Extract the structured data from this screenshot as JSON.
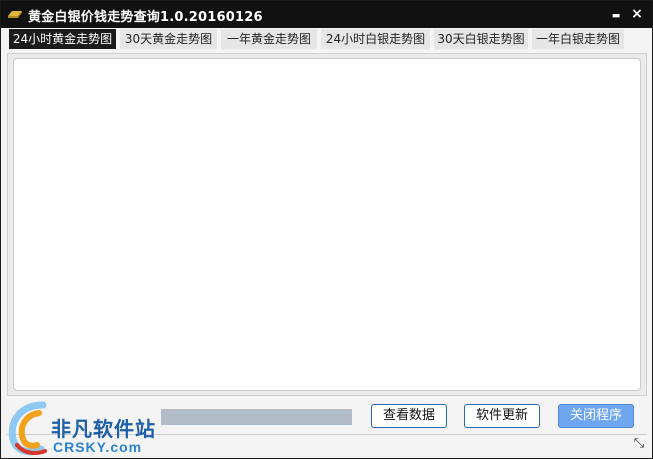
{
  "window": {
    "title": "黄金白银价钱走势查询1.0.20160126",
    "minimize_glyph": "▬",
    "close_glyph": "×",
    "icon": "gold-bar-icon"
  },
  "tabs": [
    {
      "label": "24小时黄金走势图",
      "active": true
    },
    {
      "label": "30天黄金走势图",
      "active": false
    },
    {
      "label": "一年黄金走势图",
      "active": false
    },
    {
      "label": "24小时白银走势图",
      "active": false
    },
    {
      "label": "30天白银走势图",
      "active": false
    },
    {
      "label": "一年白银走势图",
      "active": false
    }
  ],
  "progress": {
    "fraction": 0.0
  },
  "buttons": {
    "view_data": "查看数据",
    "update": "软件更新",
    "close_program": "关闭程序"
  },
  "statusbar": {
    "resize_glyph": "⤡"
  },
  "watermark": {
    "cn": "非凡软件站",
    "en": "CRSKY.com"
  },
  "colors": {
    "titlebar": "#111111",
    "accent_blue": "#2a69b8",
    "close_btn_bg": "#6fa6f0"
  }
}
